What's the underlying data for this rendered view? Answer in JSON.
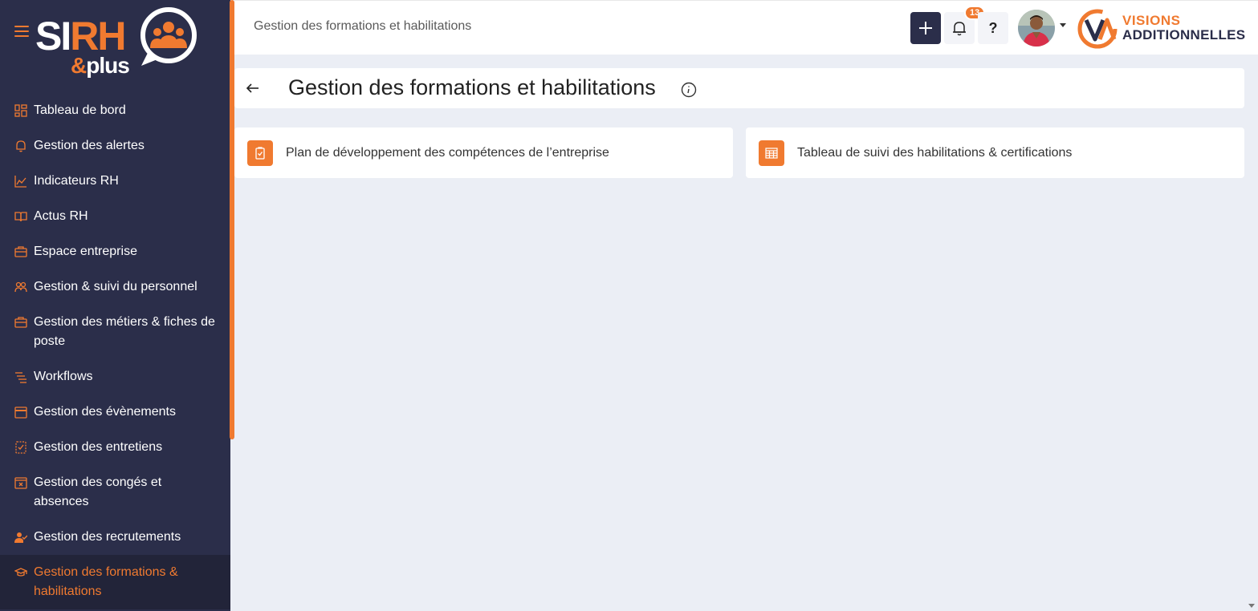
{
  "brand": {
    "logo_text_a": "SI",
    "logo_text_b": "RH",
    "logo_text_amp": "&",
    "logo_text_plus": "plus",
    "accent_color": "#f07a30",
    "sidebar_color": "#2b2e4a"
  },
  "sidebar": {
    "items": [
      {
        "label": "Tableau de bord",
        "icon": "dashboard-icon"
      },
      {
        "label": "Gestion des alertes",
        "icon": "bell-icon"
      },
      {
        "label": "Indicateurs RH",
        "icon": "line-chart-icon"
      },
      {
        "label": "Actus RH",
        "icon": "book-icon"
      },
      {
        "label": "Espace entreprise",
        "icon": "briefcase-icon"
      },
      {
        "label": "Gestion & suivi du personnel",
        "icon": "users-icon"
      },
      {
        "label": "Gestion des métiers & fiches de poste",
        "icon": "briefcase-icon"
      },
      {
        "label": "Workflows",
        "icon": "workflow-icon"
      },
      {
        "label": "Gestion des évènements",
        "icon": "calendar-icon"
      },
      {
        "label": "Gestion des entretiens",
        "icon": "checklist-icon"
      },
      {
        "label": "Gestion des congés et absences",
        "icon": "calendar-x-icon"
      },
      {
        "label": "Gestion des recrutements",
        "icon": "user-check-icon"
      },
      {
        "label": "Gestion des formations & habilitations",
        "icon": "graduation-cap-icon",
        "active": true
      }
    ]
  },
  "topbar": {
    "title": "Gestion des formations et habilitations",
    "notification_count": "13",
    "help_label": "?",
    "partner_line1": "VISIONS",
    "partner_line2": "ADDITIONNELLES"
  },
  "page": {
    "title": "Gestion des formations et habilitations"
  },
  "cards": [
    {
      "label": "Plan de développement des compétences de l’entreprise",
      "icon": "clipboard-check-icon"
    },
    {
      "label": "Tableau de suivi des habilitations & certifications",
      "icon": "table-icon"
    }
  ]
}
